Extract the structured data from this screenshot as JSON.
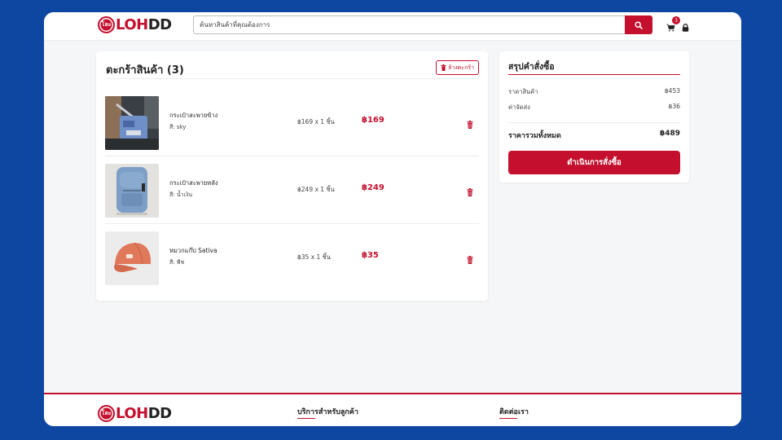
{
  "header": {
    "logo": {
      "mark": "โละ",
      "brand_red": "LOH",
      "brand_dark": "DD"
    },
    "search": {
      "placeholder": "ค้นหาสินค้าที่คุณต้องการ",
      "value": ""
    },
    "cart_count": "3"
  },
  "cart": {
    "title": "ตะกร้าสินค้า (3)",
    "clear_label": "ล้างตะกร้า",
    "items": [
      {
        "name": "กระเป๋าสะพายข้าง",
        "color": "สี: sky",
        "qty": "฿169 x 1 ชิ้น",
        "total": "฿169"
      },
      {
        "name": "กระเป๋าสะพายหลัง",
        "color": "สี: น้ำเงิน",
        "qty": "฿249 x 1 ชิ้น",
        "total": "฿249"
      },
      {
        "name": "หมวกแก๊ป Sativa",
        "color": "สี: พีช",
        "qty": "฿35 x 1 ชิ้น",
        "total": "฿35"
      }
    ]
  },
  "summary": {
    "title": "สรุปคำสั่งซื้อ",
    "subtotal_label": "ราคาสินค้า",
    "subtotal_value": "฿453",
    "shipping_label": "ค่าจัดส่ง",
    "shipping_value": "฿36",
    "total_label": "ราคารวมทั้งหมด",
    "total_value": "฿489",
    "checkout_label": "ดำเนินการสั่งซื้อ"
  },
  "footer": {
    "logo": {
      "mark": "โละ",
      "brand_red": "LOH",
      "brand_dark": "DD"
    },
    "col1_title": "บริการสำหรับลูกค้า",
    "col2_title": "ติดต่อเรา"
  },
  "colors": {
    "accent": "#c4102e",
    "background": "#0d47a1",
    "page": "#f5f6f8"
  },
  "icons": [
    "search-icon",
    "cart-icon",
    "lock-icon",
    "trash-icon"
  ]
}
